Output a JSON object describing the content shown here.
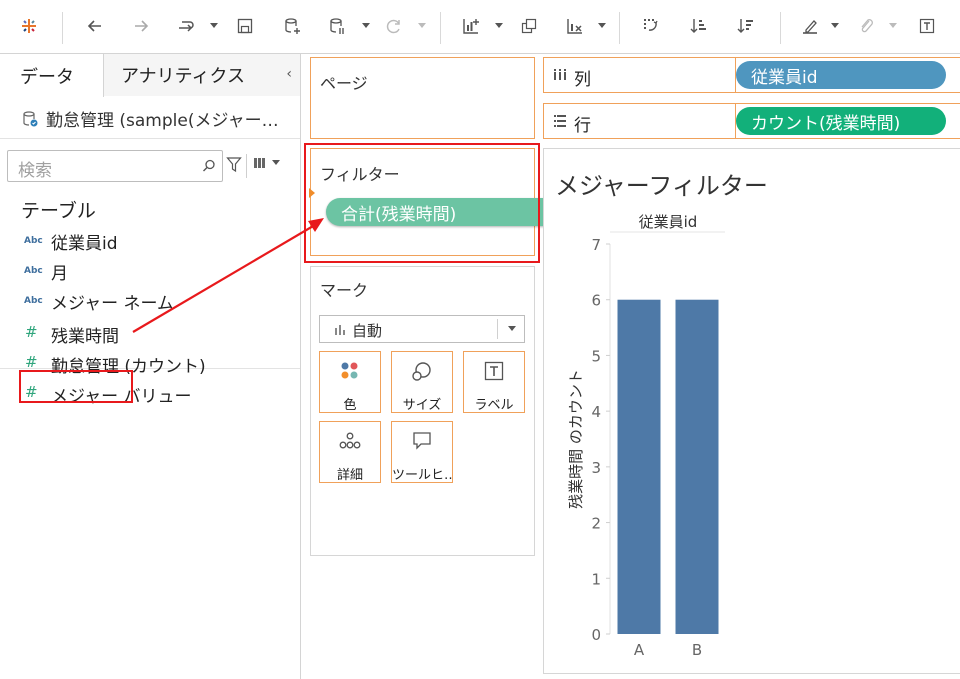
{
  "toolbar": {
    "icons": [
      "tableau-logo-icon",
      "undo-icon",
      "redo-icon",
      "replay-icon",
      "save-icon",
      "new-datasource-icon",
      "pause-updates-icon",
      "refresh-icon",
      "new-sheet-icon",
      "duplicate-sheet-icon",
      "clear-sheet-icon",
      "swap-icon",
      "sort-ascending-icon",
      "sort-descending-icon",
      "highlight-icon",
      "annotate-icon",
      "text-icon"
    ]
  },
  "data_pane": {
    "tabs": {
      "data": "データ",
      "analytics": "アナリティクス"
    },
    "collapse_glyph": "‹",
    "datasource": "勤怠管理 (sample(メジャー…",
    "search_placeholder": "検索",
    "section_title": "テーブル",
    "dimensions": [
      {
        "type_label": "Abc",
        "name": "従業員id"
      },
      {
        "type_label": "Abc",
        "name": "月"
      },
      {
        "type_label": "Abc",
        "name": "メジャー ネーム"
      }
    ],
    "measures": [
      {
        "type_label": "#",
        "name": "残業時間"
      },
      {
        "type_label": "#",
        "name": "勤怠管理 (カウント)"
      },
      {
        "type_label": "#",
        "name": "メジャー バリュー"
      }
    ]
  },
  "cards": {
    "pages_title": "ページ",
    "filters_title": "フィルター",
    "filter_pill": "合計(残業時間)",
    "marks_title": "マーク",
    "mark_type": "自動",
    "mark_buttons": [
      "色",
      "サイズ",
      "ラベル",
      "詳細",
      "ツールヒ…"
    ]
  },
  "shelves": {
    "columns_label": "列",
    "columns_pill": "従業員id",
    "rows_label": "行",
    "rows_pill": "カウント(残業時間)"
  },
  "sheet_title": "メジャーフィルター",
  "colors": {
    "bar": "#4e79a7",
    "filter_pill": "#6cc4a3",
    "columns_pill": "#4f96bf",
    "rows_pill": "#12b07a",
    "highlight": "#e8191c",
    "shelf_border": "#f0a15a"
  },
  "chart_data": {
    "type": "bar",
    "title": "",
    "header": "従業員id",
    "categories": [
      "A",
      "B"
    ],
    "values": [
      6,
      6
    ],
    "ylabel": "残業時間 のカウント",
    "xlabel": "",
    "ylim": [
      0,
      7
    ],
    "yticks": [
      0,
      1,
      2,
      3,
      4,
      5,
      6,
      7
    ],
    "grid": false
  }
}
